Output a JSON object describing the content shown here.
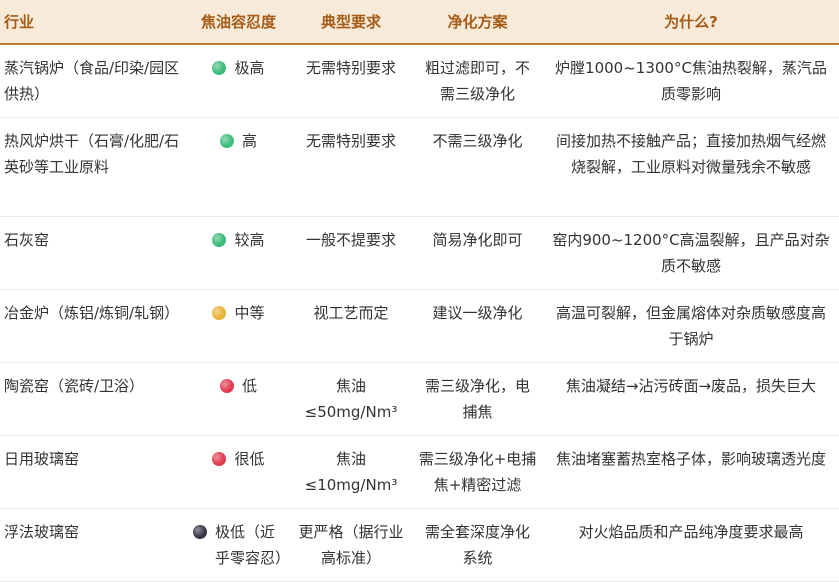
{
  "table": {
    "headers": [
      "行业",
      "焦油容忍度",
      "典型要求",
      "净化方案",
      "为什么?"
    ],
    "rows": [
      {
        "industry": "蒸汽锅炉（食品/印染/园区供热）",
        "tolerance": "极高",
        "tolerance_color": "#3dbb7a",
        "requirement": "无需特别要求",
        "solution": "粗过滤即可，不需三级净化",
        "reason": "炉膛1000~1300°C焦油热裂解，蒸汽品质零影响"
      },
      {
        "industry": "热风炉烘干（石膏/化肥/石英砂等工业原料",
        "tolerance": "高",
        "tolerance_color": "#3dbb7a",
        "requirement": "无需特别要求",
        "solution": "不需三级净化",
        "reason": "间接加热不接触产品；直接加热烟气经燃烧裂解，工业原料对微量残余不敏感"
      },
      {
        "industry": "石灰窑",
        "tolerance": "较高",
        "tolerance_color": "#3dbb7a",
        "requirement": "一般不提要求",
        "solution": "简易净化即可",
        "reason": "窑内900~1200°C高温裂解，且产品对杂质不敏感"
      },
      {
        "industry": "冶金炉（炼铝/炼铜/轧钢）",
        "tolerance": "中等",
        "tolerance_color": "#e8b23a",
        "requirement": "视工艺而定",
        "solution": "建议一级净化",
        "reason": "高温可裂解，但金属熔体对杂质敏感度高于锅炉"
      },
      {
        "industry": "陶瓷窑（瓷砖/卫浴）",
        "tolerance": "低",
        "tolerance_color": "#e23a4e",
        "requirement": "焦油≤50mg/Nm³",
        "solution": "需三级净化，电捕焦",
        "reason": "焦油凝结→沾污砖面→废品，损失巨大"
      },
      {
        "industry": "日用玻璃窑",
        "tolerance": "很低",
        "tolerance_color": "#e23a4e",
        "requirement": "焦油≤10mg/Nm³",
        "solution": "需三级净化+电捕焦+精密过滤",
        "reason": "焦油堵塞蓄热室格子体，影响玻璃透光度"
      },
      {
        "industry": "浮法玻璃窑",
        "tolerance": "极低（近乎零容忍）",
        "tolerance_color": "#3a3447",
        "requirement": "更严格（据行业高标准）",
        "solution": "需全套深度净化系统",
        "reason": "对火焰品质和产品纯净度要求最高"
      }
    ]
  }
}
